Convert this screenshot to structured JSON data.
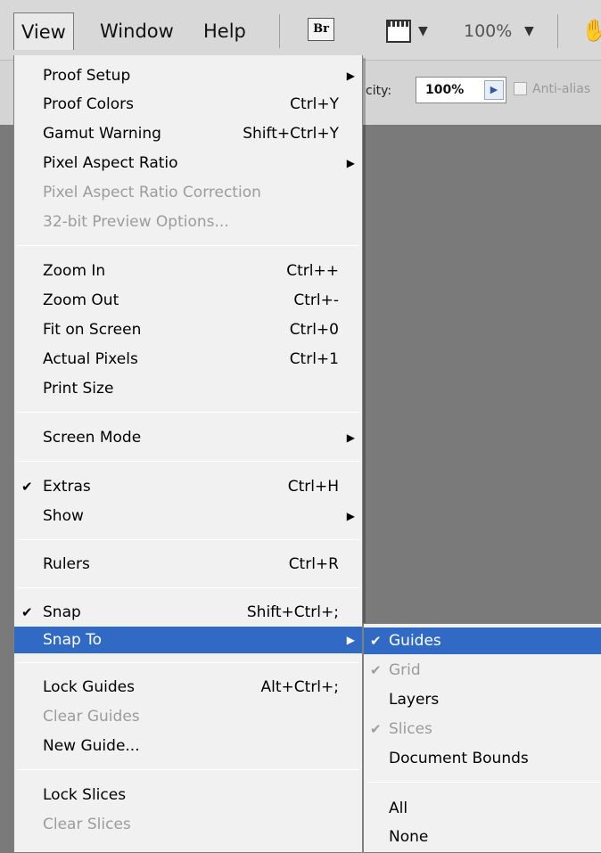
{
  "menubar": {
    "items": [
      "View",
      "Window",
      "Help"
    ],
    "bridge_label": "Br",
    "zoom": "100%"
  },
  "options": {
    "opacity_label": "city:",
    "opacity_value": "100%",
    "antialias_label": "Anti-alias"
  },
  "view_menu": {
    "items": [
      {
        "label": "Proof Setup",
        "shortcut": ""
      },
      {
        "label": "Proof Colors",
        "shortcut": "Ctrl+Y"
      },
      {
        "label": "Gamut Warning",
        "shortcut": "Shift+Ctrl+Y"
      },
      {
        "label": "Pixel Aspect Ratio",
        "shortcut": ""
      },
      {
        "label": "Pixel Aspect Ratio Correction",
        "shortcut": ""
      },
      {
        "label": "32-bit Preview Options...",
        "shortcut": ""
      },
      {
        "label": "Zoom In",
        "shortcut": "Ctrl++"
      },
      {
        "label": "Zoom Out",
        "shortcut": "Ctrl+-"
      },
      {
        "label": "Fit on Screen",
        "shortcut": "Ctrl+0"
      },
      {
        "label": "Actual Pixels",
        "shortcut": "Ctrl+1"
      },
      {
        "label": "Print Size",
        "shortcut": ""
      },
      {
        "label": "Screen Mode",
        "shortcut": ""
      },
      {
        "label": "Extras",
        "shortcut": "Ctrl+H"
      },
      {
        "label": "Show",
        "shortcut": ""
      },
      {
        "label": "Rulers",
        "shortcut": "Ctrl+R"
      },
      {
        "label": "Snap",
        "shortcut": "Shift+Ctrl+;"
      },
      {
        "label": "Snap To",
        "shortcut": ""
      },
      {
        "label": "Lock Guides",
        "shortcut": "Alt+Ctrl+;"
      },
      {
        "label": "Clear Guides",
        "shortcut": ""
      },
      {
        "label": "New Guide...",
        "shortcut": ""
      },
      {
        "label": "Lock Slices",
        "shortcut": ""
      },
      {
        "label": "Clear Slices",
        "shortcut": ""
      }
    ]
  },
  "snap_to_menu": {
    "items": [
      "Guides",
      "Grid",
      "Layers",
      "Slices",
      "Document Bounds",
      "All",
      "None"
    ]
  }
}
